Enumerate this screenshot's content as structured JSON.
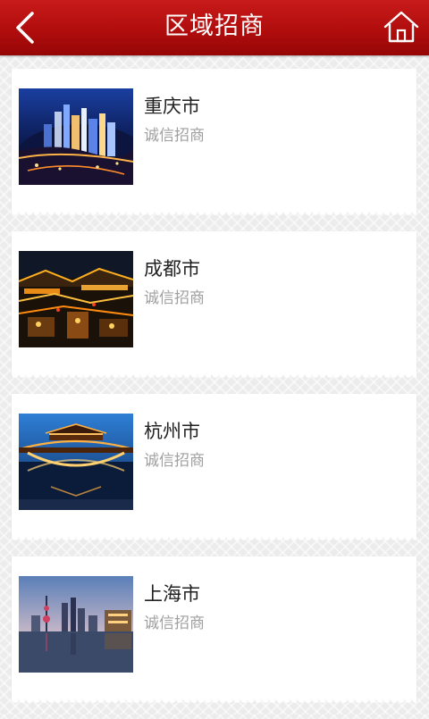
{
  "header": {
    "title": "区域招商",
    "back_icon": "chevron-left-icon",
    "home_icon": "home-icon",
    "background_color": "#b10d0d"
  },
  "cities": [
    {
      "name": "重庆市",
      "subtitle": "诚信招商",
      "image": "chongqing-night-skyline-photo"
    },
    {
      "name": "成都市",
      "subtitle": "诚信招商",
      "image": "chengdu-night-street-photo"
    },
    {
      "name": "杭州市",
      "subtitle": "诚信招商",
      "image": "hangzhou-bridge-night-photo"
    },
    {
      "name": "上海市",
      "subtitle": "诚信招商",
      "image": "shanghai-skyline-photo"
    }
  ]
}
